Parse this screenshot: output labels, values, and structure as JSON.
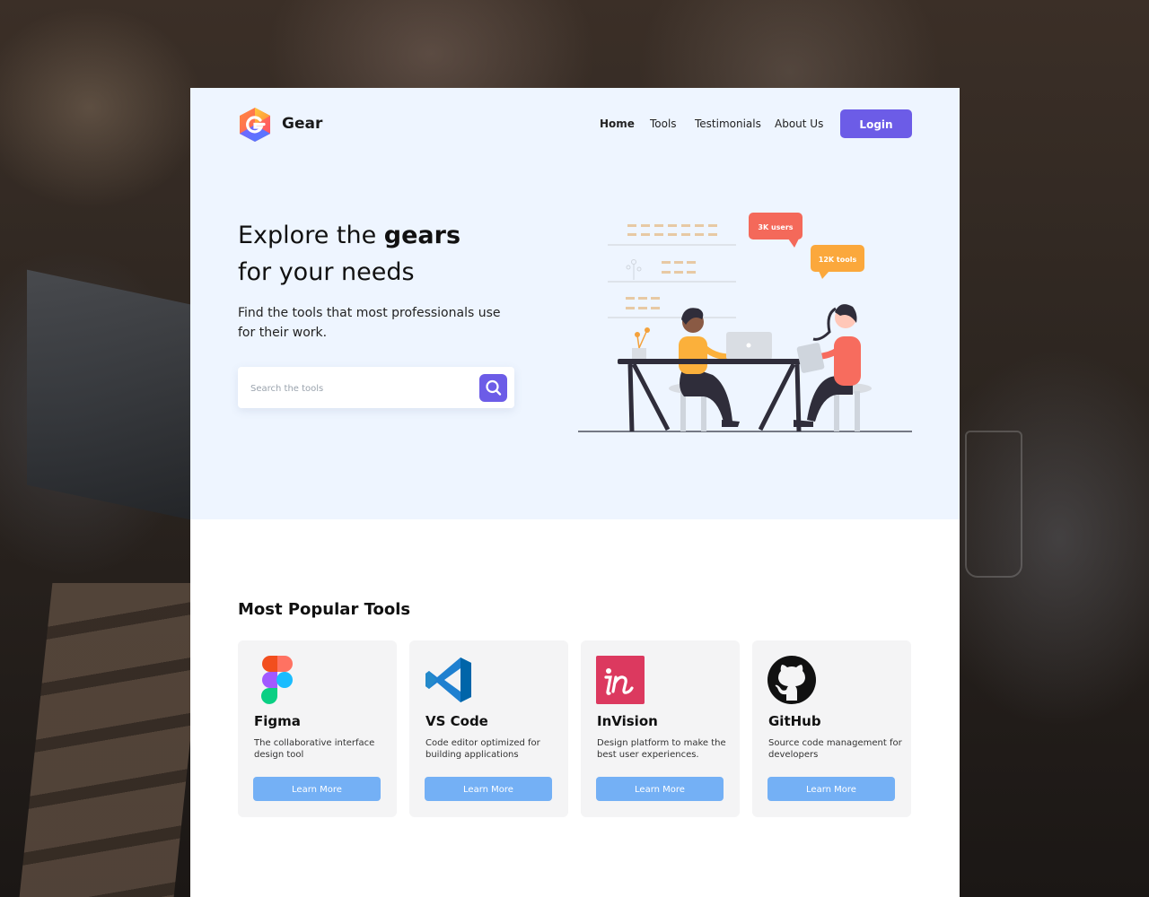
{
  "brand": {
    "name": "Gear",
    "logo_icon": "gear-logo-icon"
  },
  "nav": {
    "items": [
      {
        "label": "Home",
        "active": true
      },
      {
        "label": "Tools",
        "active": false
      },
      {
        "label": "Testimonials",
        "active": false
      },
      {
        "label": "About Us",
        "active": false
      }
    ],
    "login_label": "Login"
  },
  "hero": {
    "title_prefix": "Explore the ",
    "title_bold": "gears",
    "title_suffix": "for your needs",
    "subtitle": "Find the tools that most professionals use for their work.",
    "search_placeholder": "Search the tools",
    "search_icon": "search-icon",
    "bubble_users": "3K users",
    "bubble_tools": "12K tools"
  },
  "popular": {
    "title": "Most Popular Tools",
    "cards": [
      {
        "name": "Figma",
        "description": "The collaborative interface design tool",
        "button": "Learn More",
        "icon": "figma-icon"
      },
      {
        "name": "VS Code",
        "description": "Code editor optimized for building applications",
        "button": "Learn More",
        "icon": "vscode-icon"
      },
      {
        "name": "InVision",
        "description": "Design platform to make the best user experiences.",
        "button": "Learn More",
        "icon": "invision-icon"
      },
      {
        "name": "GitHub",
        "description": "Source code management for developers",
        "button": "Learn More",
        "icon": "github-icon"
      }
    ]
  },
  "colors": {
    "accent": "#6c5ce7",
    "hero_bg": "#eef5ff",
    "card_button": "#74b0f5",
    "bubble_red": "#f4695a",
    "bubble_orange": "#fba83c"
  }
}
